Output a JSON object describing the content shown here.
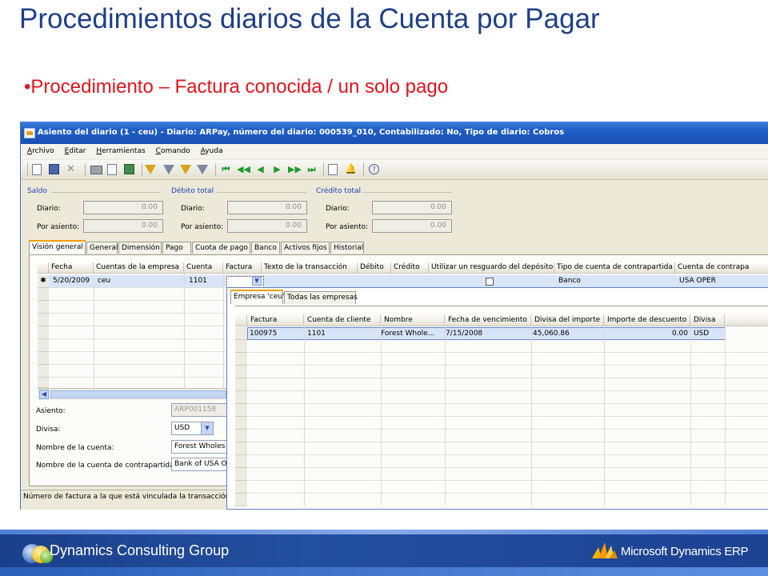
{
  "slide": {
    "title": "Procedimientos diarios de la Cuenta por Pagar",
    "bullet": "•Procedimiento – Factura conocida / un solo pago"
  },
  "window": {
    "title": "Asiento del diario (1 - ceu) - Diario: ARPay, número del diario: 000539_010, Contabilizado: No, Tipo de diario: Cobros",
    "menu": [
      "Archivo",
      "Editar",
      "Herramientas",
      "Comando",
      "Ayuda"
    ],
    "toolbar_icons": [
      "new-icon",
      "save-icon",
      "delete-icon",
      "print-icon",
      "print-preview-icon",
      "export-icon",
      "filter-icon",
      "filter-by-selection-icon",
      "advanced-filter-icon",
      "sort-icon",
      "first-record-icon",
      "previous-page-icon",
      "previous-record-icon",
      "next-record-icon",
      "next-page-icon",
      "last-record-icon",
      "attach-icon",
      "alert-icon",
      "help-icon"
    ],
    "totals": {
      "saldo": {
        "label": "Saldo",
        "diario_label": "Diario:",
        "diario_value": "0.00",
        "asiento_label": "Por asiento:",
        "asiento_value": "0.00"
      },
      "debito": {
        "label": "Débito total",
        "diario_label": "Diario:",
        "diario_value": "0.00",
        "asiento_label": "Por asiento:",
        "asiento_value": "0.00"
      },
      "credito": {
        "label": "Crédito total",
        "diario_label": "Diario:",
        "diario_value": "0.00",
        "asiento_label": "Por asiento:",
        "asiento_value": "0.00"
      }
    },
    "tabs": [
      "Visión general",
      "General",
      "Dimensión",
      "Pago",
      "Cuota de pago",
      "Banco",
      "Activos fijos",
      "Historial"
    ],
    "grid": {
      "columns": [
        "Fecha",
        "Cuentas de la empresa",
        "Cuenta",
        "Factura",
        "Texto de la transacción",
        "Débito",
        "Crédito",
        "Utilizar un resguardo del depósito",
        "Tipo de cuenta de contrapartida",
        "Cuenta de contrapa"
      ],
      "row": {
        "marker": "✱",
        "fecha": "5/20/2009",
        "empresa": "ceu",
        "cuenta": "1101",
        "factura": "",
        "tipo": "Banco",
        "contrapartida": "USA OPER"
      }
    },
    "fields": {
      "asiento": {
        "label": "Asiento:",
        "value": "ARP001158"
      },
      "divisa": {
        "label": "Divisa:",
        "value": "USD"
      },
      "nombre_cuenta": {
        "label": "Nombre de la cuenta:",
        "value": "Forest Wholes"
      },
      "nombre_contrapartida": {
        "label": "Nombre de la cuenta de contrapartida:",
        "value": "Bank of USA O"
      }
    },
    "status": "Número de factura a la que está vinculada la transacción"
  },
  "lookup": {
    "tabs": [
      "Empresa 'ceu'",
      "Todas las empresas"
    ],
    "columns": [
      "Factura",
      "Cuenta de cliente",
      "Nombre",
      "Fecha de vencimiento",
      "Divisa del importe",
      "Importe de descuento",
      "Divisa"
    ],
    "rows": [
      {
        "factura": "100975",
        "cuenta": "1101",
        "nombre": "Forest Whole...",
        "fecha": "7/15/2008",
        "importe": "45,060.86",
        "descuento": "0.00",
        "divisa": "USD"
      }
    ]
  },
  "footer": {
    "company": "Dynamics Consulting Group",
    "product": "Microsoft Dynamics ERP"
  },
  "colors": {
    "title": "#1f3f86",
    "bullet": "#e0151d",
    "titlebar": "#1f5fc8",
    "footer": "#1a3f8a"
  }
}
